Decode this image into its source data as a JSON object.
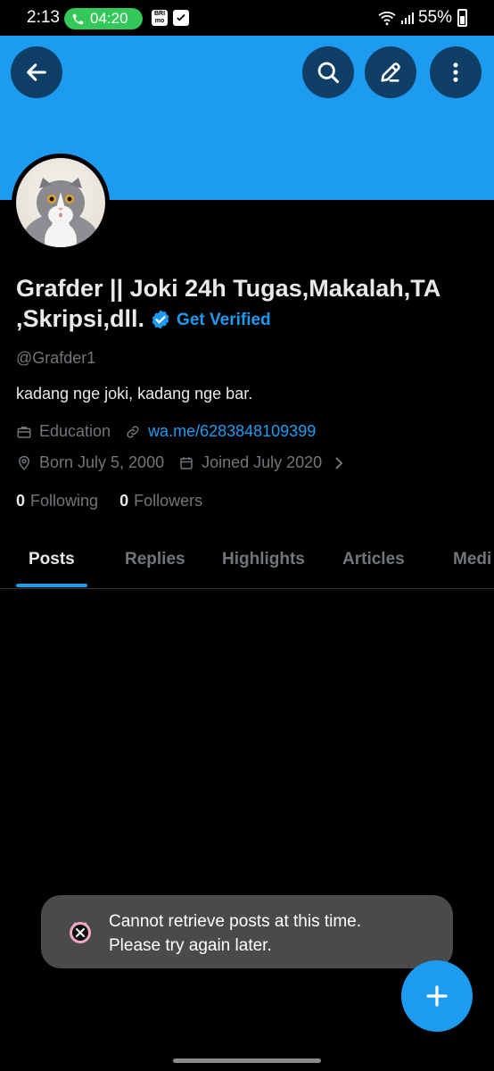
{
  "status_bar": {
    "time": "2:13",
    "call_timer": "04:20",
    "app_icon_1": "BRI mo",
    "battery": "55%",
    "icons": [
      "phone-icon",
      "check-box-icon",
      "wifi-icon",
      "signal-icon",
      "battery-icon"
    ]
  },
  "header": {
    "banner_color": "#1d9bf0",
    "buttons": [
      "back-arrow-icon",
      "search-icon",
      "edit-pencil-icon",
      "more-vertical-icon"
    ]
  },
  "profile": {
    "name": "Grafder || Joki 24h Tugas,Makalah,TA ,Skripsi,dll.",
    "get_verified": "Get Verified",
    "handle": "@Grafder1",
    "bio": "kadang nge joki, kadang nge bar.",
    "category": "Education",
    "website": "wa.me/6283848109399",
    "born": "Born July 5, 2000",
    "joined": "Joined July 2020",
    "following_count": "0",
    "following_label": "Following",
    "followers_count": "0",
    "followers_label": "Followers"
  },
  "tabs": [
    {
      "label": "Posts",
      "active": true
    },
    {
      "label": "Replies",
      "active": false
    },
    {
      "label": "Highlights",
      "active": false
    },
    {
      "label": "Articles",
      "active": false
    },
    {
      "label": "Medi",
      "active": false
    }
  ],
  "toast": {
    "message_line1": "Cannot retrieve posts at this time.",
    "message_line2": "Please try again later."
  },
  "colors": {
    "accent": "#1d9bf0",
    "background": "#000000",
    "muted": "#71767b"
  }
}
